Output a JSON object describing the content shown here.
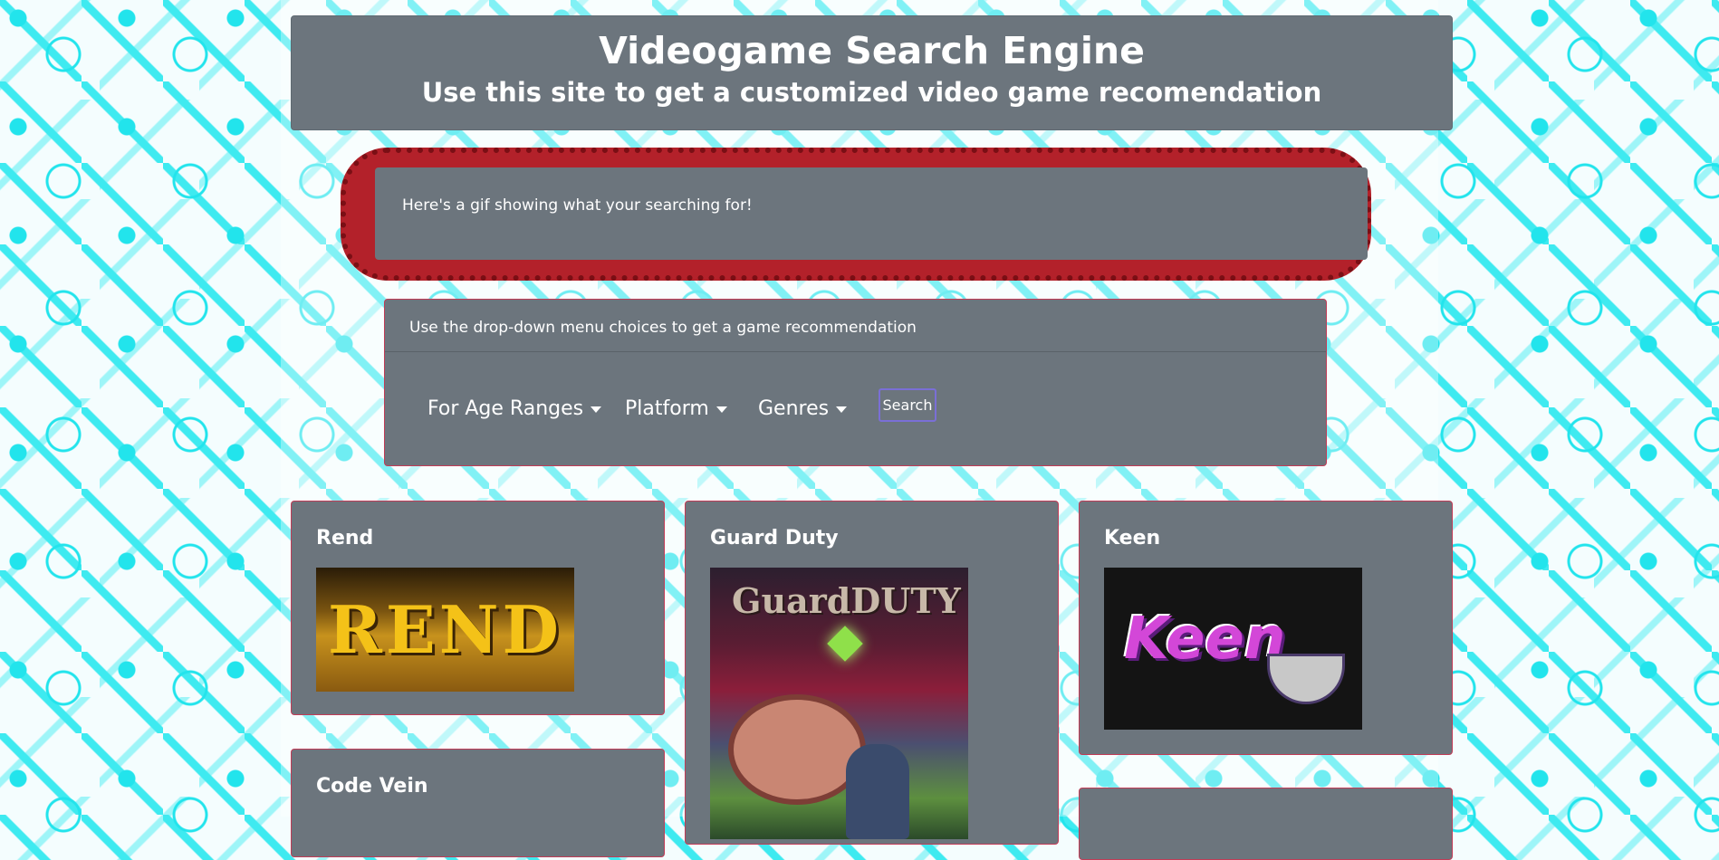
{
  "header": {
    "title": "Videogame Search Engine",
    "subtitle": "Use this site to get a customized video game recomendation"
  },
  "gif_panel": {
    "text": "Here's a gif showing what your searching for!"
  },
  "menu": {
    "instruction": "Use the drop-down menu choices to get a game recommendation",
    "dropdowns": [
      {
        "label": "For Age Ranges"
      },
      {
        "label": "Platform"
      },
      {
        "label": "Genres"
      }
    ],
    "search_label": "Search"
  },
  "games": [
    {
      "title": "Rend",
      "image_text": "REND"
    },
    {
      "title": "Guard Duty",
      "image_text": "GuardDUTY"
    },
    {
      "title": "Keen",
      "image_text": "Keen"
    },
    {
      "title": "Code Vein"
    }
  ],
  "colors": {
    "panel": "#6c757d",
    "gif_border": "#b3212a",
    "card_border": "#c23b56",
    "background_pattern": "#22e4ec"
  }
}
